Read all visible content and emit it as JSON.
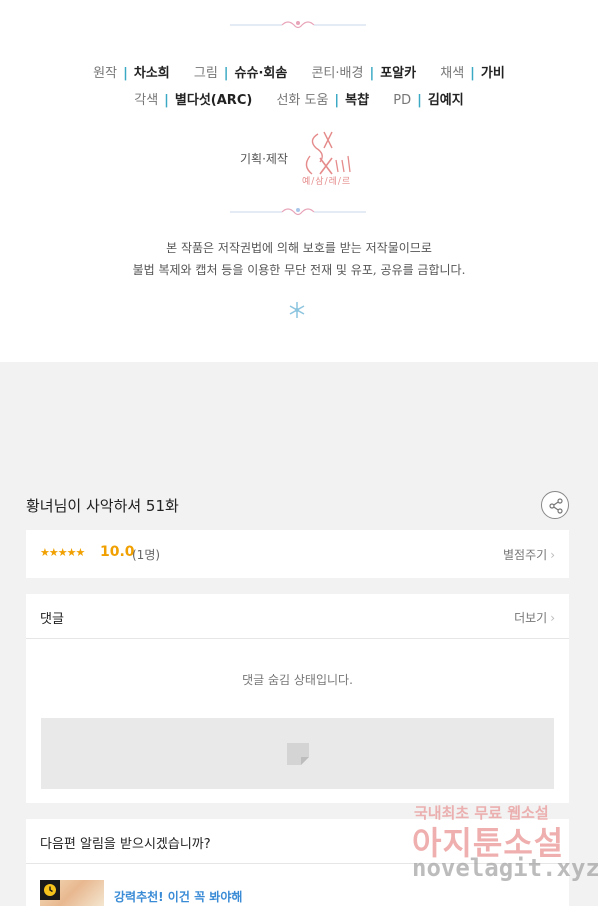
{
  "credits": {
    "row1": [
      {
        "role": "원작",
        "name": "차소희"
      },
      {
        "role": "그림",
        "name": "슈슈·회솜"
      },
      {
        "role": "콘티·배경",
        "name": "포알카"
      },
      {
        "role": "채색",
        "name": "가비"
      }
    ],
    "row2": [
      {
        "role": "각색",
        "name": "별다섯(ARC)"
      },
      {
        "role": "선화 도움",
        "name": "복챱"
      },
      {
        "role": "PD",
        "name": "김예지"
      }
    ],
    "plan_label": "기획·제작",
    "logo_sub": "예/삼/레/르",
    "notice_line1": "본 작품은 저작권법에 의해 보호를 받는 저작물이므로",
    "notice_line2": "불법 복제와 캡처 등을 이용한 무단 전재 및 유포, 공유를 금합니다."
  },
  "episode": {
    "title": "황녀님이 사악하셔 51화"
  },
  "rating": {
    "stars": "★★★★★",
    "score": "10.0",
    "count": "(1명)",
    "rate_label": "별점주기"
  },
  "comments": {
    "title": "댓글",
    "more_label": "더보기",
    "hidden_message": "댓글 숨김 상태입니다."
  },
  "notify": {
    "question": "다음편 알림을 받으시겠습니까?",
    "recommend_text": "강력추천! 이건 꼭 봐야해"
  },
  "watermark": {
    "line1": "국내최초 무료 웹소설",
    "line2": "아지툰소설",
    "line3": "novelagit.xyz"
  },
  "colors": {
    "accent_separator": "#39a9c4",
    "star": "#f0a000",
    "link_blue": "#3a8bd6"
  }
}
